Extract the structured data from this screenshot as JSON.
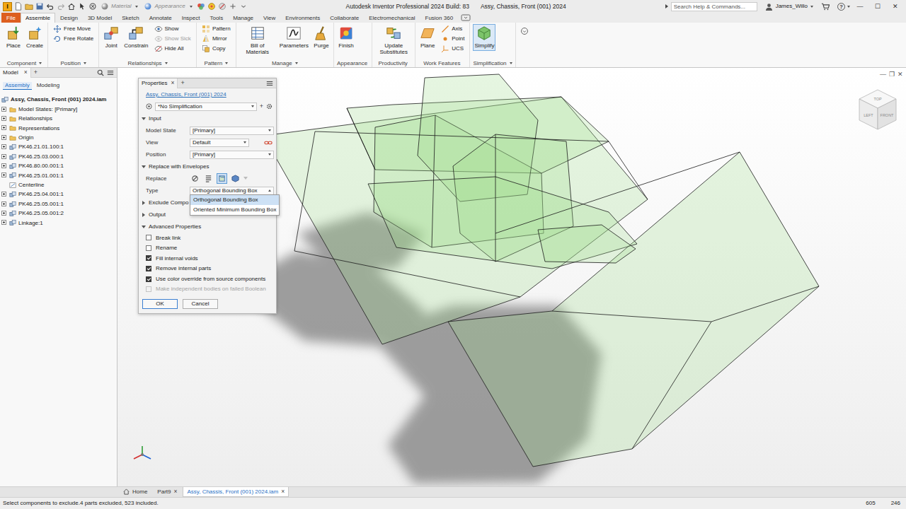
{
  "window": {
    "app_icon": "I",
    "app_title": "Autodesk Inventor Professional 2024 Build: 83",
    "document_title": "Assy, Chassis, Front (001) 2024",
    "controls": [
      "—",
      "☐",
      "✕"
    ]
  },
  "quick_access": {
    "material": "Material",
    "appearance": "Appearance"
  },
  "search": {
    "placeholder": "Search Help & Commands..."
  },
  "user": {
    "name": "James_Willo",
    "help": "?"
  },
  "ribbon": {
    "file_menu": "File",
    "tabs": [
      {
        "label": "Assemble",
        "selected": true
      },
      {
        "label": "Design",
        "selected": false
      },
      {
        "label": "3D Model",
        "selected": false
      },
      {
        "label": "Sketch",
        "selected": false
      },
      {
        "label": "Annotate",
        "selected": false
      },
      {
        "label": "Inspect",
        "selected": false
      },
      {
        "label": "Tools",
        "selected": false
      },
      {
        "label": "Manage",
        "selected": false
      },
      {
        "label": "View",
        "selected": false
      },
      {
        "label": "Environments",
        "selected": false
      },
      {
        "label": "Collaborate",
        "selected": false
      },
      {
        "label": "Electromechanical",
        "selected": false
      },
      {
        "label": "Fusion 360",
        "selected": false
      }
    ],
    "groups": [
      {
        "label": "Component",
        "menu": true,
        "commands": [
          {
            "label": "Place",
            "kind": "large",
            "selected": false,
            "disabled": false
          },
          {
            "label": "Create",
            "kind": "large",
            "selected": false,
            "disabled": false
          }
        ]
      },
      {
        "label": "Position",
        "menu": true,
        "commands": [
          {
            "label": "Free Move",
            "kind": "small",
            "selected": false,
            "disabled": false
          },
          {
            "label": "Free Rotate",
            "kind": "small",
            "selected": false,
            "disabled": false
          }
        ]
      },
      {
        "label": "Relationships",
        "menu": true,
        "commands": [
          {
            "label": "Joint",
            "kind": "large",
            "selected": false,
            "disabled": false
          },
          {
            "label": "Constrain",
            "kind": "large",
            "selected": false,
            "disabled": false
          },
          {
            "label": "Show",
            "kind": "small",
            "selected": false,
            "disabled": false
          },
          {
            "label": "Show Sick",
            "kind": "small",
            "selected": false,
            "disabled": true
          },
          {
            "label": "Hide All",
            "kind": "small",
            "selected": false,
            "disabled": false
          }
        ]
      },
      {
        "label": "Pattern",
        "menu": true,
        "commands": [
          {
            "label": "Pattern",
            "kind": "small",
            "selected": false,
            "disabled": false
          },
          {
            "label": "Mirror",
            "kind": "small",
            "selected": false,
            "disabled": false
          },
          {
            "label": "Copy",
            "kind": "small",
            "selected": false,
            "disabled": false
          }
        ]
      },
      {
        "label": "Manage",
        "menu": true,
        "commands": [
          {
            "label": "Bill of Materials",
            "kind": "large",
            "selected": false,
            "disabled": false
          },
          {
            "label": "Parameters",
            "kind": "large",
            "selected": false,
            "disabled": false
          },
          {
            "label": "Purge",
            "kind": "large",
            "selected": false,
            "disabled": false
          }
        ]
      },
      {
        "label": "Appearance",
        "menu": false,
        "commands": [
          {
            "label": "Finish",
            "kind": "large",
            "selected": false,
            "disabled": false
          }
        ]
      },
      {
        "label": "Productivity",
        "menu": false,
        "commands": [
          {
            "label": "Update Substitutes",
            "kind": "large",
            "selected": false,
            "disabled": false
          }
        ]
      },
      {
        "label": "Work Features",
        "menu": false,
        "commands": [
          {
            "label": "Plane",
            "kind": "large",
            "selected": false,
            "disabled": false
          },
          {
            "label": "Axis",
            "kind": "small",
            "selected": false,
            "disabled": false
          },
          {
            "label": "Point",
            "kind": "small",
            "selected": false,
            "disabled": false
          },
          {
            "label": "UCS",
            "kind": "small",
            "selected": false,
            "disabled": false
          }
        ]
      },
      {
        "label": "Simplification",
        "menu": true,
        "commands": [
          {
            "label": "Simplify",
            "kind": "large",
            "selected": true,
            "disabled": false
          }
        ]
      }
    ]
  },
  "browser": {
    "tab": "Model",
    "close": "×",
    "add": "+",
    "views": [
      {
        "label": "Assembly",
        "selected": true
      },
      {
        "label": "Modeling",
        "selected": false
      }
    ],
    "root": "Assy, Chassis, Front (001) 2024.iam",
    "items": [
      {
        "label": "Model States: [Primary]",
        "kind": "folder",
        "expandable": true,
        "expanded": false
      },
      {
        "label": "Relationships",
        "kind": "folder",
        "expandable": true,
        "expanded": false
      },
      {
        "label": "Representations",
        "kind": "folder",
        "expandable": true,
        "expanded": false
      },
      {
        "label": "Origin",
        "kind": "folder",
        "expandable": true,
        "expanded": false
      },
      {
        "label": "PK46.21.01.100:1",
        "kind": "assembly",
        "expandable": true,
        "expanded": false
      },
      {
        "label": "PK46.25.03.000:1",
        "kind": "assembly",
        "expandable": true,
        "expanded": false
      },
      {
        "label": "PK46.80.00.001:1",
        "kind": "assembly",
        "expandable": true,
        "expanded": false
      },
      {
        "label": "PK46.25.01.001:1",
        "kind": "assembly",
        "expandable": true,
        "expanded": false
      },
      {
        "label": "Centerline",
        "kind": "sketch",
        "expandable": false,
        "expanded": false
      },
      {
        "label": "PK46.25.04.001:1",
        "kind": "assembly",
        "expandable": true,
        "expanded": false
      },
      {
        "label": "PK46.25.05.001:1",
        "kind": "assembly",
        "expandable": true,
        "expanded": false
      },
      {
        "label": "PK46.25.05.001:2",
        "kind": "assembly",
        "expandable": true,
        "expanded": false
      },
      {
        "label": "Linkage:1",
        "kind": "assembly",
        "expandable": true,
        "expanded": false
      }
    ]
  },
  "viewport": {
    "viewcube": [
      "TOP",
      "LEFT",
      "FRONT"
    ],
    "controls": [
      "—",
      "❐",
      "✕"
    ]
  },
  "properties": {
    "title": "Properties",
    "close": "×",
    "add": "+",
    "source": "Assy, Chassis, Front (001) 2024",
    "preset": "*No Simplification",
    "preset_add": "+",
    "input": {
      "label": "Input",
      "expanded": true,
      "fields": [
        {
          "label": "Model State",
          "value": "[Primary]",
          "link": false
        },
        {
          "label": "View",
          "value": "Default",
          "link": true
        },
        {
          "label": "Position",
          "value": "[Primary]",
          "link": false
        }
      ]
    },
    "envelopes": {
      "label": "Replace with Envelopes",
      "expanded": true,
      "replace_label": "Replace",
      "replace_options": [
        {
          "selected": false
        },
        {
          "selected": false
        },
        {
          "selected": true
        },
        {
          "selected": false
        }
      ],
      "type_label": "Type",
      "type_value": "Orthogonal Bounding Box",
      "type_open": true,
      "type_options": [
        {
          "label": "Orthogonal Bounding Box",
          "selected": true
        },
        {
          "label": "Oriented Minimum Bounding Box",
          "selected": false
        }
      ]
    },
    "exclude": {
      "label": "Exclude Compo",
      "expanded": false
    },
    "output": {
      "label": "Output",
      "expanded": false
    },
    "advanced": {
      "label": "Advanced Properties",
      "expanded": true,
      "options": [
        {
          "label": "Break link",
          "checked": false,
          "disabled": false
        },
        {
          "label": "Rename",
          "checked": false,
          "disabled": false
        },
        {
          "label": "Fill internal voids",
          "checked": true,
          "disabled": false
        },
        {
          "label": "Remove internal parts",
          "checked": true,
          "disabled": false
        },
        {
          "label": "Use color override from source components",
          "checked": true,
          "disabled": false
        },
        {
          "label": "Make independent bodies on failed Boolean",
          "checked": false,
          "disabled": true
        }
      ]
    },
    "buttons": [
      {
        "label": "OK",
        "default": true
      },
      {
        "label": "Cancel",
        "default": false
      }
    ]
  },
  "document_tabs": {
    "close": "×",
    "tabs": [
      {
        "label": "Home",
        "selected": false,
        "closable": false
      },
      {
        "label": "Part9",
        "selected": false,
        "closable": true
      },
      {
        "label": "Assy, Chassis, Front (001) 2024.iam",
        "selected": true,
        "closable": true
      }
    ]
  },
  "status_bar": {
    "message": "Select components to exclude.4 parts excluded, 523 included.",
    "x": "605",
    "y": "246"
  }
}
